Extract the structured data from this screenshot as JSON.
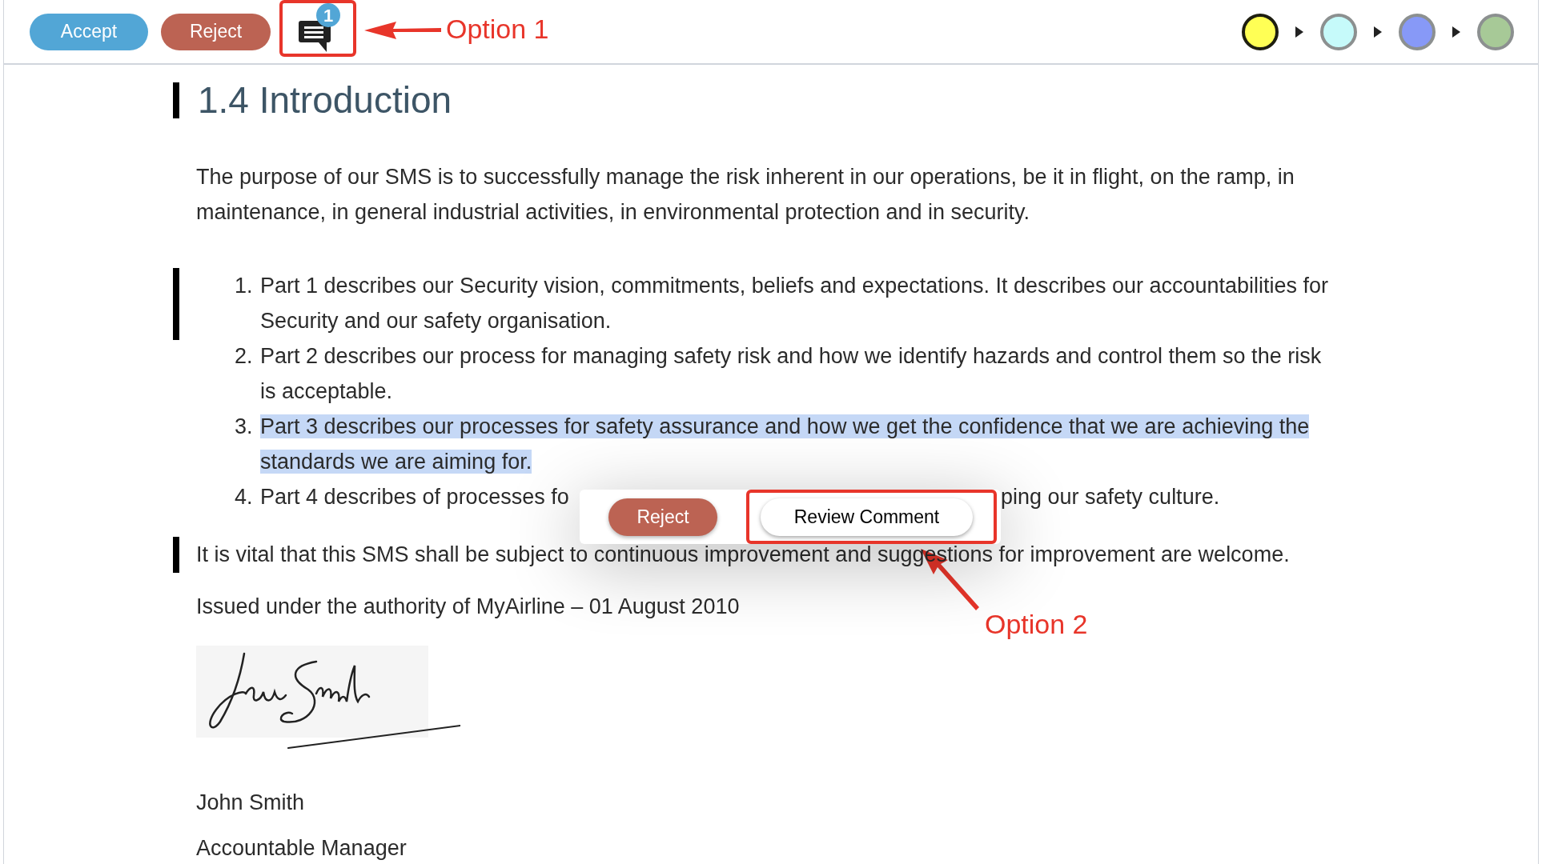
{
  "toolbar": {
    "buttons": [
      {
        "label": "Accept",
        "kind": "accept"
      },
      {
        "label": "Reject",
        "kind": "reject"
      }
    ],
    "comments": {
      "count": "1"
    },
    "stages": [
      {
        "color": "#ffff55",
        "selected": true
      },
      {
        "color": "#c6fafa",
        "selected": false
      },
      {
        "color": "#8799f7",
        "selected": false
      },
      {
        "color": "#a7c997",
        "selected": false
      }
    ]
  },
  "document": {
    "blocks": [
      {
        "kind": "heading",
        "changed": true,
        "text": "1.4 Introduction"
      },
      {
        "kind": "paragraph",
        "changed": false,
        "text": "The purpose of our SMS is to successfully manage the risk inherent in our operations, be it in flight, on the ramp, in maintenance, in general industrial activities, in environmental protection and in security."
      },
      {
        "kind": "list",
        "changed": true,
        "items": [
          {
            "number": "1.",
            "text": "Part 1 describes our Security vision, commitments, beliefs and expectations.  It describes our accountabilities for Security and our safety organisation.",
            "selected": false
          },
          {
            "number": "2.",
            "text": "Part 2 describes our process for managing safety risk and how we identify hazards and control them so the risk is acceptable.",
            "selected": false
          },
          {
            "number": "3.",
            "text": "Part 3 describes our processes for safety assurance and how we get the confidence that we are achieving the standards we are aiming for.",
            "selected": true
          },
          {
            "number": "4.",
            "text": "Part 4 describes of processes fo",
            "text_after": "ping our safety culture.",
            "selected": false
          }
        ]
      },
      {
        "kind": "paragraph",
        "changed": true,
        "text": "It is vital that this SMS shall be subject to continuous improvement and suggestions for improvement are welcome."
      },
      {
        "kind": "paragraph",
        "changed": false,
        "text": "Issued under the authority of MyAirline – 01 August 2010"
      },
      {
        "kind": "signature",
        "changed": false
      },
      {
        "kind": "paragraph",
        "changed": false,
        "text": "John Smith"
      },
      {
        "kind": "paragraph",
        "changed": false,
        "text": "Accountable Manager"
      }
    ]
  },
  "popup": {
    "buttons": [
      {
        "label": "Reject",
        "kind": "reject"
      },
      {
        "label": "Review Comment",
        "kind": "review"
      }
    ]
  },
  "annotations": [
    {
      "label": "Option 1"
    },
    {
      "label": "Option 2"
    }
  ]
}
